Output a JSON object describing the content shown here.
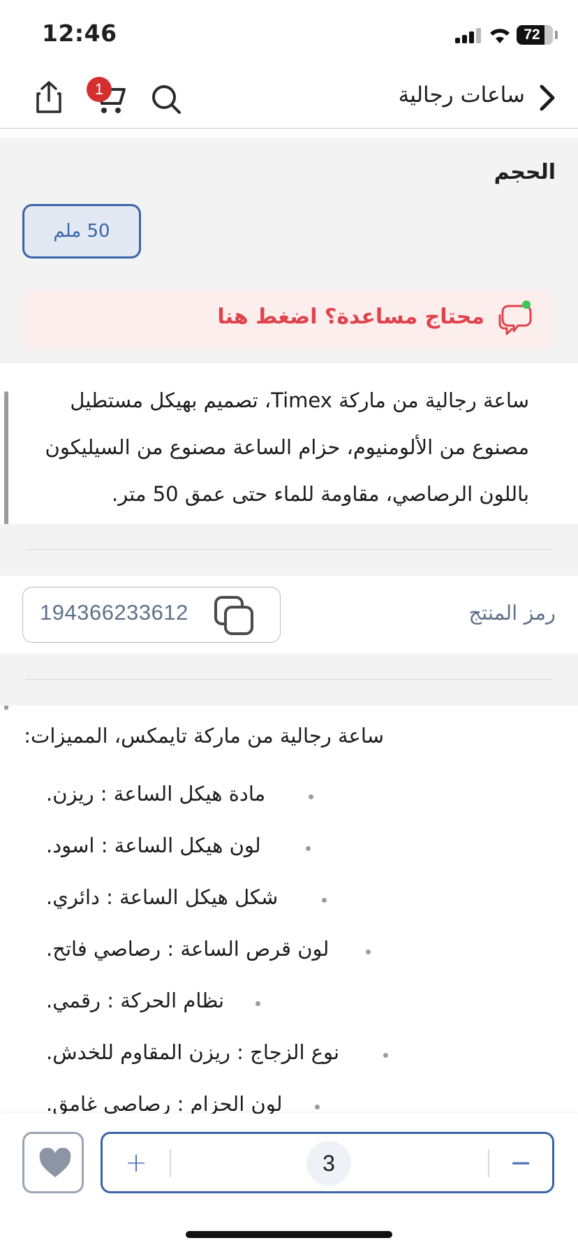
{
  "status_bar": {
    "time": "12:46",
    "battery": "72"
  },
  "nav": {
    "title": "ساعات رجالية",
    "cart_count": "1"
  },
  "size_section": {
    "title": "الحجم",
    "selected_option": "50 ملم"
  },
  "help_banner": {
    "text": "محتاج مساعدة؟ اضغط هنا"
  },
  "description": {
    "lines": [
      "ساعة رجالية من ماركة Timex، تصميم بهيكل مستطيل",
      "مصنوع من الألومنيوم، حزام الساعة مصنوع من السيليكون",
      "باللون الرصاصي، مقاومة للماء حتى عمق 50 متر."
    ]
  },
  "product_code": {
    "label": "رمز المنتج",
    "value": "194366233612"
  },
  "features": {
    "title": "ساعة رجالية من ماركة تايمكس، المميزات:",
    "items": [
      "مادة هيكل الساعة : ريزن.",
      "لون هيكل الساعة : اسود.",
      "شكل هيكل الساعة : دائري.",
      "لون قرص الساعة : رصاصي فاتح.",
      "نظام الحركة : رقمي.",
      "نوع الزجاج : ريزن المقاوم للخدش.",
      "لون الحزام : رصاصي غامق."
    ]
  },
  "bottom_bar": {
    "quantity": "3",
    "plus": "+",
    "minus": "−"
  },
  "colors": {
    "accent": "#3a64a8",
    "alert": "#e0434b",
    "badge": "#d32f2f"
  }
}
